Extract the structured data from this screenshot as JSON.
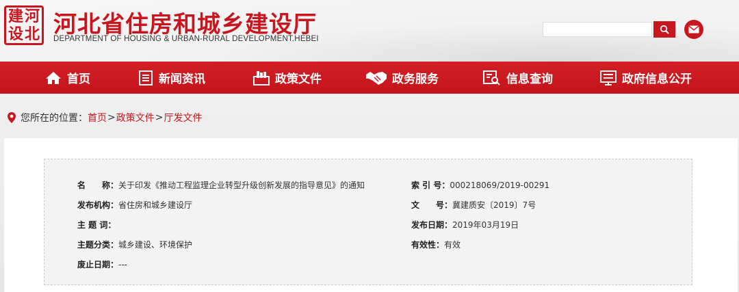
{
  "header": {
    "logo_chars": [
      "建",
      "河",
      "设",
      "北"
    ],
    "title": "河北省住房和城乡建设厅",
    "subtitle": "DEPARTMENT OF HOUSING & URBAN-RURAL DEVELOPMENT.HEBEI",
    "search_placeholder": "",
    "search_icon": "search-icon",
    "mail_icon": "mail-icon",
    "accent_color": "#c8161e"
  },
  "nav": {
    "items": [
      {
        "label": "首页",
        "icon": "home-icon"
      },
      {
        "label": "新闻资讯",
        "icon": "news-icon"
      },
      {
        "label": "政策文件",
        "icon": "policy-document-icon"
      },
      {
        "label": "政务服务",
        "icon": "handshake-icon"
      },
      {
        "label": "信息查询",
        "icon": "info-search-icon"
      },
      {
        "label": "政府信息公开",
        "icon": "open-info-icon"
      }
    ]
  },
  "breadcrumb": {
    "prefix": "您所在的位置：",
    "items": [
      "首页",
      "政策文件",
      "厅发文件"
    ],
    "separator": ">"
  },
  "meta": {
    "name_label": "名　　称：",
    "name_value": "关于印发《推动工程监理企业转型升级创新发展的指导意见》的通知",
    "index_label": "索 引 号：",
    "index_value": "000218069/2019-00291",
    "issuer_label": "发布机构：",
    "issuer_value": "省住房和城乡建设厅",
    "docno_label": "文　　号：",
    "docno_value": "冀建质安〔2019〕7号",
    "subject_label": "主 题 词：",
    "subject_value": "",
    "date_label": "发布日期：",
    "date_value": "2019年03月19日",
    "category_label": "主题分类：",
    "category_value": "城乡建设、环境保护",
    "validity_label": "有效性：",
    "validity_value": "有效",
    "expiry_label": "废止日期：",
    "expiry_value": "---"
  }
}
